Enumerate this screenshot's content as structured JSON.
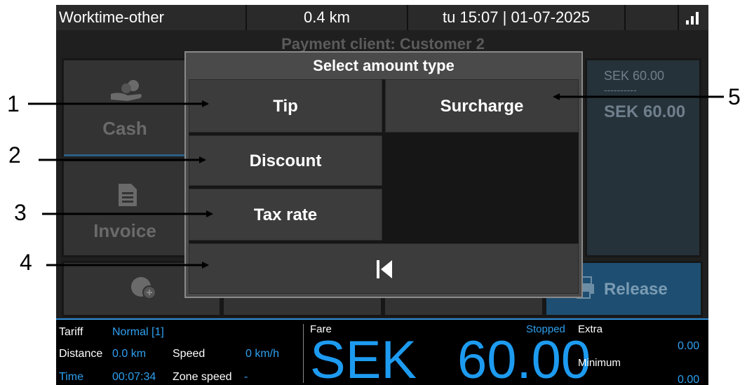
{
  "status_bar": {
    "mode": "Worktime-other",
    "distance": "0.4 km",
    "datetime": "tu 15:07 | 01-07-2025"
  },
  "background": {
    "title": "Payment client: Customer 2",
    "cash_label": "Cash",
    "invoice_label": "Invoice",
    "amount_top": "SEK 60.00",
    "amount_sep": "----------",
    "amount_total": "SEK 60.00",
    "release_label": "Release"
  },
  "modal": {
    "title": "Select amount type",
    "buttons": {
      "tip": "Tip",
      "surcharge": "Surcharge",
      "discount": "Discount",
      "tax_rate": "Tax rate"
    }
  },
  "info_bar": {
    "tariff_label": "Tariff",
    "tariff_value": "Normal [1]",
    "distance_label": "Distance",
    "distance_value": "0.0 km",
    "speed_label": "Speed",
    "speed_value": "0 km/h",
    "time_label": "Time",
    "time_value": "00:07:34",
    "zone_speed_label": "Zone speed",
    "zone_speed_value": "-",
    "fare_label": "Fare",
    "fare_status": "Stopped",
    "fare_currency": "SEK",
    "fare_amount": "60.00",
    "extra_label": "Extra",
    "extra_value": "0.00",
    "minimum_label": "Minimum",
    "minimum_value": "0.00"
  },
  "annotations": [
    "1",
    "2",
    "3",
    "4",
    "5"
  ],
  "colors": {
    "accent_blue": "#2ea0f0",
    "modal_bg": "#4a4a4a",
    "button_bg": "#3c3c3c"
  }
}
